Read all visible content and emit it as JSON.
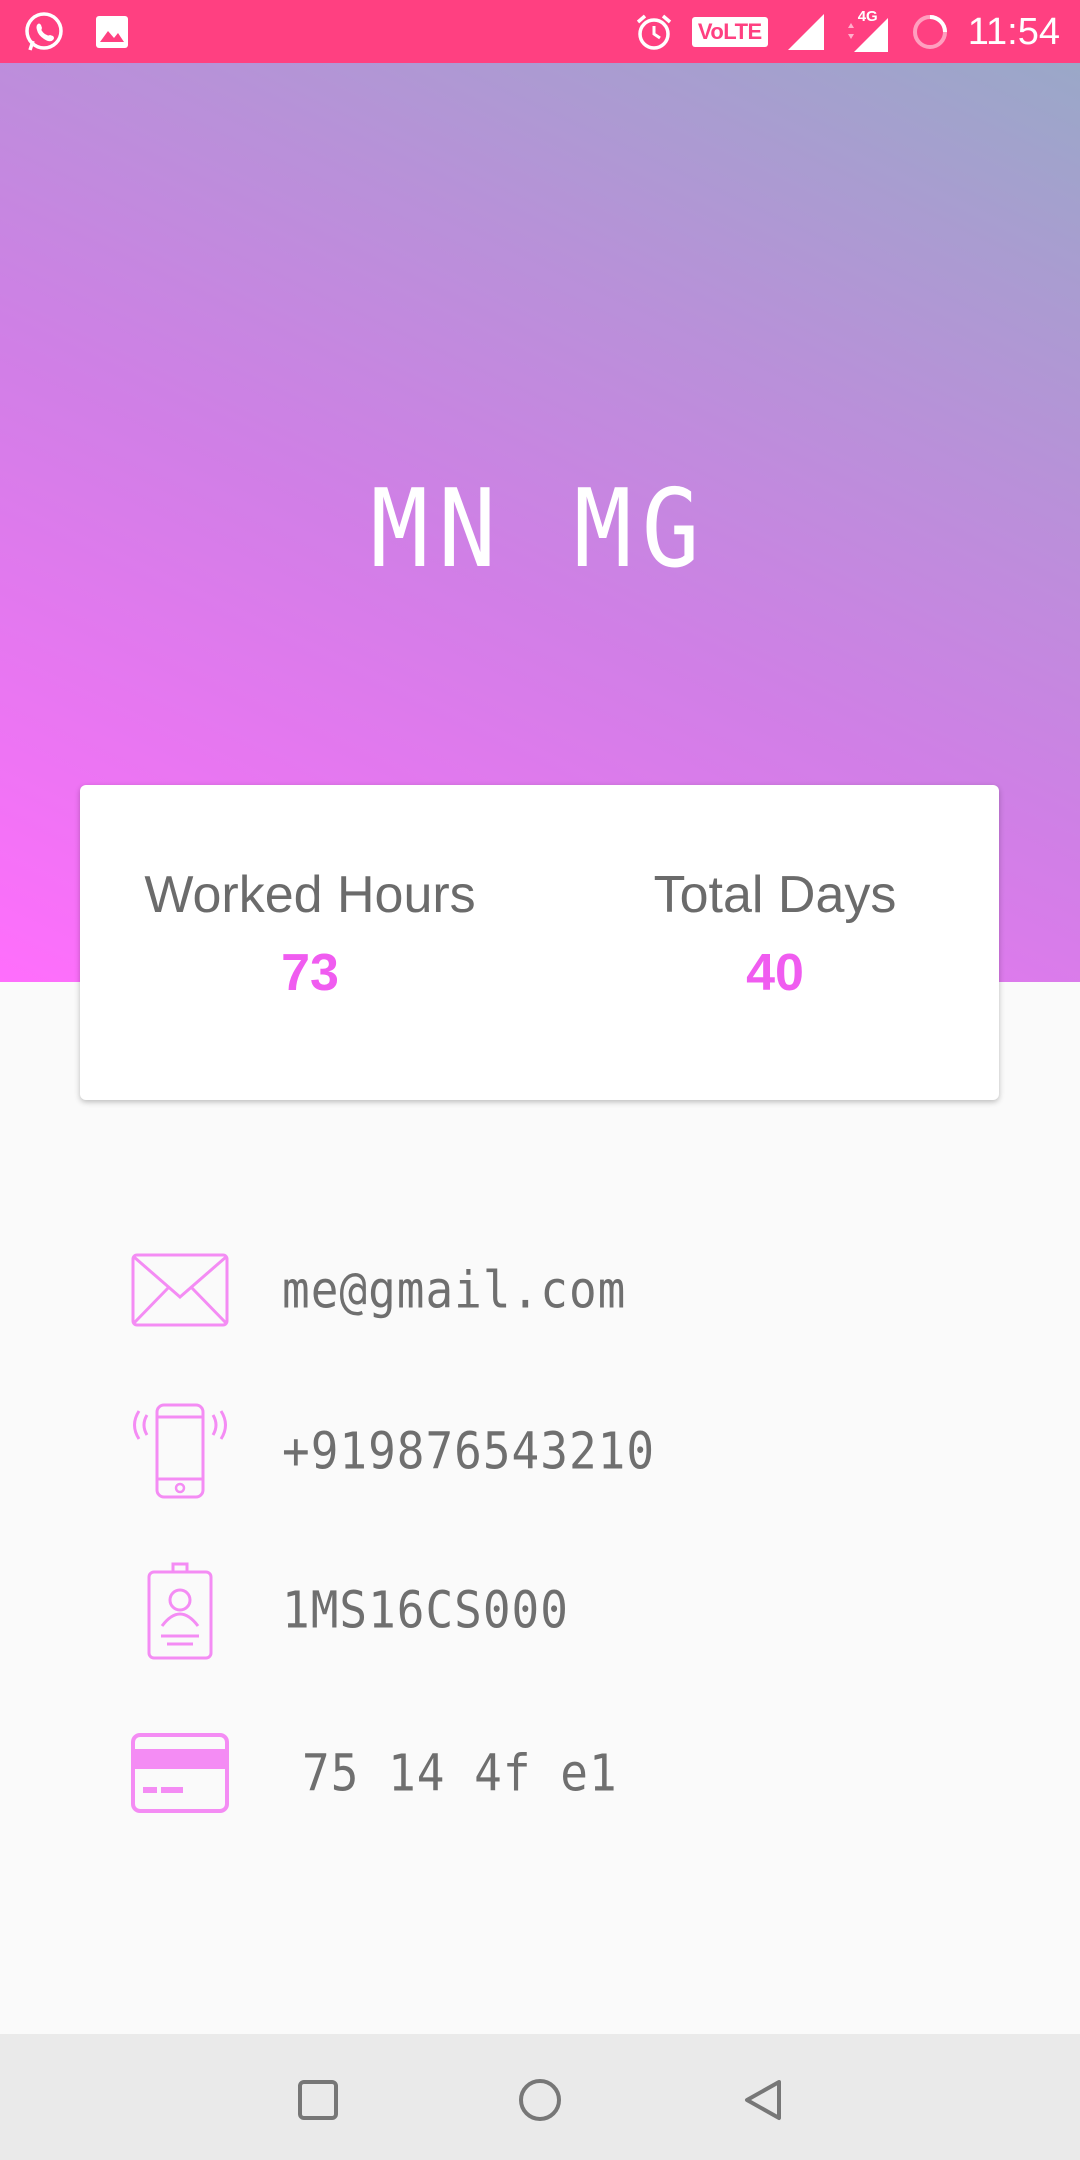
{
  "status_bar": {
    "time": "11:54",
    "volte": "VoLTE",
    "network": "4G",
    "icons": [
      "whatsapp-icon",
      "gallery-icon",
      "alarm-icon",
      "volte-icon",
      "signal-icon",
      "signal-4g-icon",
      "loading-icon"
    ]
  },
  "header": {
    "title": "MN MG"
  },
  "stats": {
    "worked_hours_label": "Worked Hours",
    "worked_hours_value": "73",
    "total_days_label": "Total Days",
    "total_days_value": "40"
  },
  "info": {
    "email": "me@gmail.com",
    "phone": "+919876543210",
    "id": "1MS16CS000",
    "card": "75 14 4f e1"
  },
  "colors": {
    "status_bar": "#ff4081",
    "accent": "#f05cf0",
    "gradient_start": "#ff6efc",
    "gradient_end": "#9aa8c8"
  }
}
